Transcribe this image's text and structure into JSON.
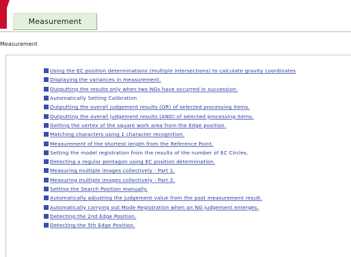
{
  "tab": {
    "label": "Measurement"
  },
  "section": {
    "label": "Measurement"
  },
  "links": [
    {
      "text": "Using the EC position determinations (multiple intersections) to calculate gravity coordinates",
      "underlined": true
    },
    {
      "text": "Displaying the variances in measurement.",
      "underlined": true
    },
    {
      "text": "Outputting the results only when two NGs have occurred in succession.",
      "underlined": true
    },
    {
      "text": "Automatically Setting Calibration",
      "underlined": false
    },
    {
      "text": "Outputting the overall judgement results (OR) of selected processing items.",
      "underlined": true
    },
    {
      "text": "Outputting the overall judgement results (AND) of selected processing items.",
      "underlined": true
    },
    {
      "text": "Getting the vertex of the square work area from the Edge position.",
      "underlined": true
    },
    {
      "text": "Matching characters using 1 character recognition.",
      "underlined": true
    },
    {
      "text": "Measurement of the shortest length from the Reference Point.",
      "underlined": true
    },
    {
      "text": "Setting the model registration from the results of the number of EC Circles.",
      "underlined": false
    },
    {
      "text": "Detecting a regular pentagon using EC position determination.",
      "underlined": true
    },
    {
      "text": "Measuring multiple images collectively - Part 1.",
      "underlined": true
    },
    {
      "text": "Measuring multiple images collectively - Part 2.",
      "underlined": true
    },
    {
      "text": "Setting the Search Position manually.",
      "underlined": true
    },
    {
      "text": "Automatically adjusting the judgement value from the past measurement result.",
      "underlined": true
    },
    {
      "text": "Automatically carrying out Mode Registration when an NG judgement emerges.",
      "underlined": true
    },
    {
      "text": "Detecting the 2nd Edge Position.",
      "underlined": true
    },
    {
      "text": "Detecting the 5th Edge Position.",
      "underlined": true
    }
  ],
  "colors": {
    "accent_red": "#c8102e",
    "tab_green": "#e3f1dc",
    "link_blue": "#233a9a",
    "bullet_blue": "#3c4fa8"
  },
  "icons": {
    "bullet": "square-bullet-icon"
  }
}
